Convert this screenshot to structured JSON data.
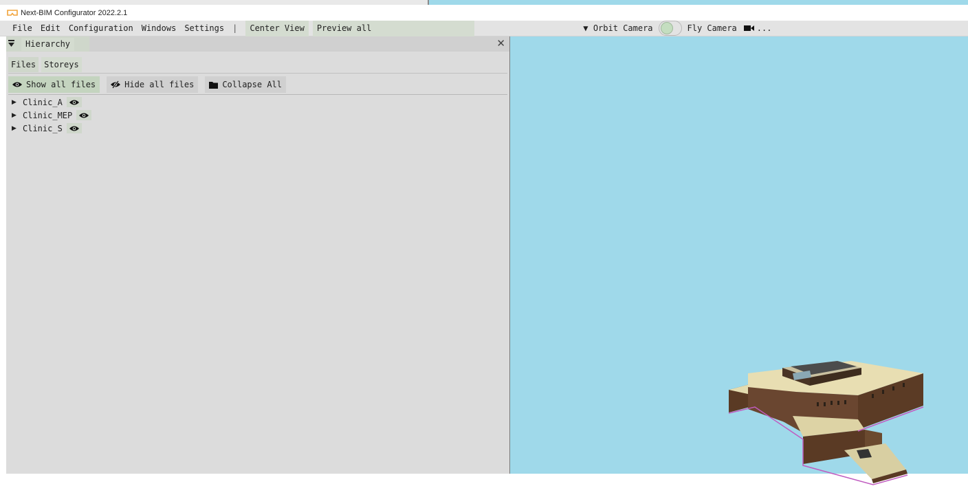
{
  "window": {
    "title": "Next-BIM Configurator 2022.2.1",
    "icon": "vr-headset-icon",
    "accent_color": "#f2a33a"
  },
  "menubar": {
    "items": [
      "File",
      "Edit",
      "Configuration",
      "Windows",
      "Settings"
    ],
    "separator": "|",
    "center_view": "Center View",
    "preview_all": "Preview all",
    "camera_menu_arrow": "▼",
    "orbit_camera": "Orbit Camera",
    "fly_camera": "Fly Camera",
    "more": "...",
    "camera_toggle_on": false
  },
  "panel": {
    "title": "Hierarchy",
    "tabs": [
      "Files",
      "Storeys"
    ],
    "active_tab": "Files",
    "toolbar": {
      "show_all": "Show all files",
      "hide_all": "Hide all files",
      "collapse_all": "Collapse All"
    },
    "files": [
      {
        "name": "Clinic_A"
      },
      {
        "name": "Clinic_MEP"
      },
      {
        "name": "Clinic_S"
      }
    ]
  },
  "viewport": {
    "background_color": "#9fd9ea",
    "model": "building-model"
  }
}
